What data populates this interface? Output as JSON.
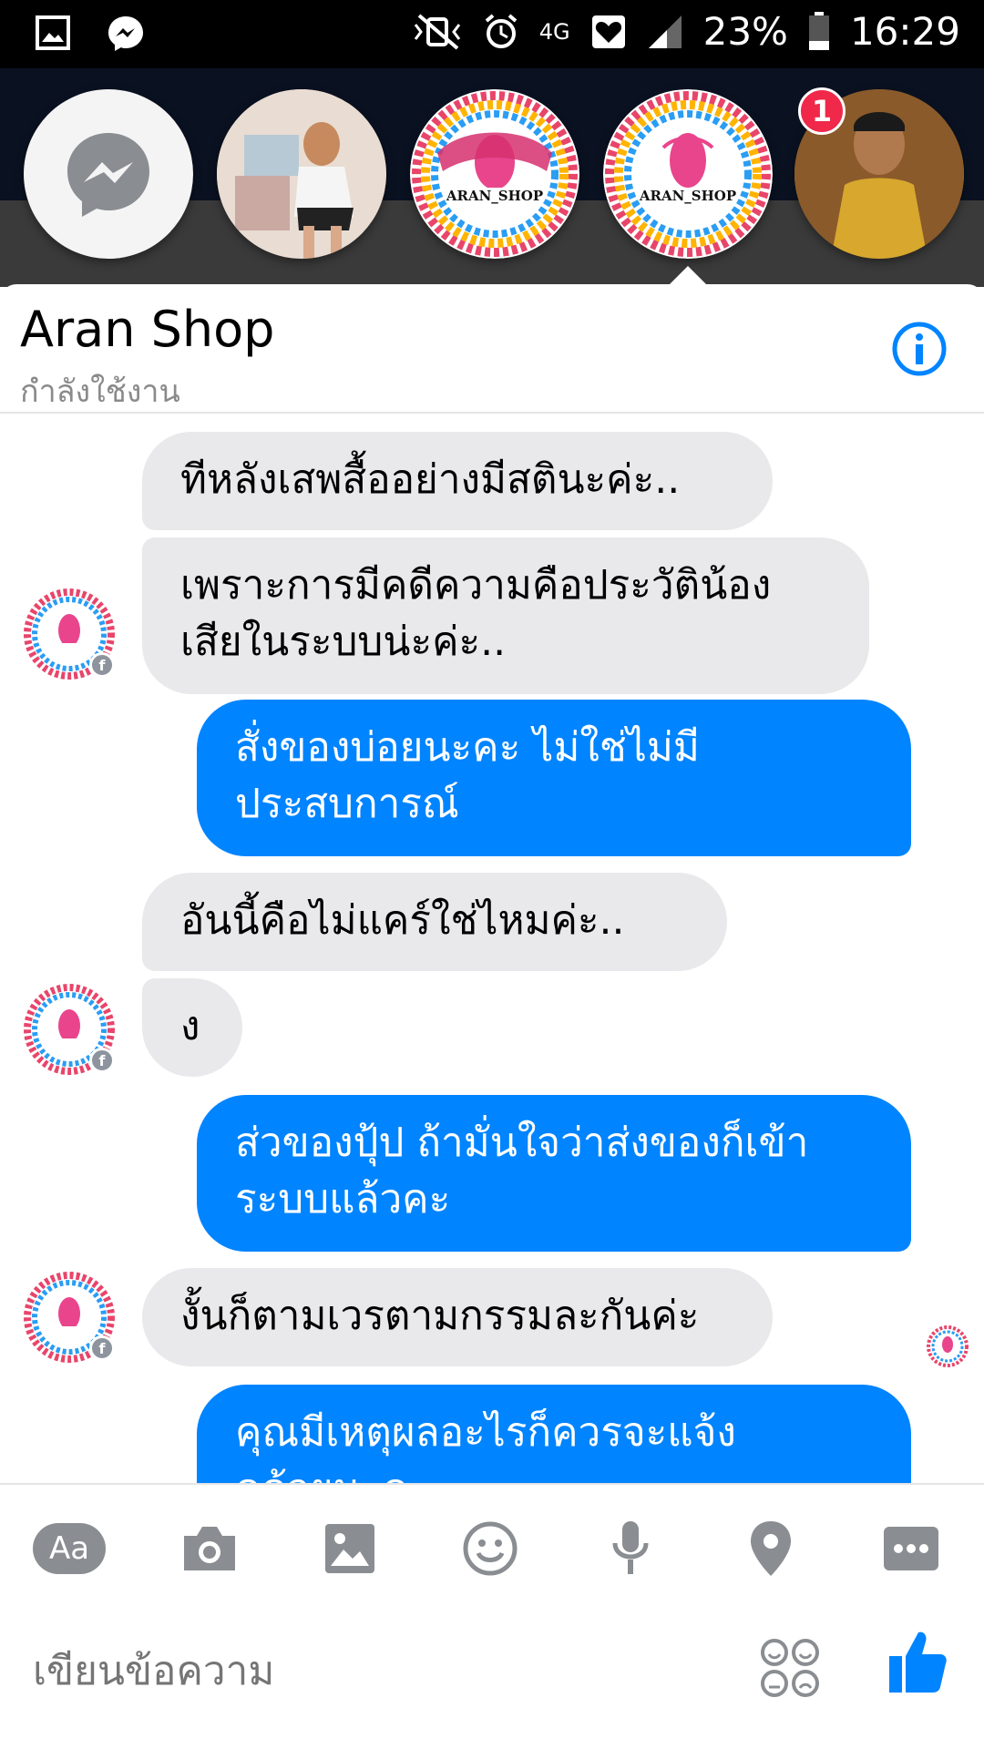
{
  "status_bar": {
    "battery": "23%",
    "time": "16:29",
    "network": "4G"
  },
  "chat_heads": {
    "badge_count": "1",
    "shop_logo_text": "ARAN_SHOP"
  },
  "conversation": {
    "title": "Aran Shop",
    "status": "กำลังใช้งาน"
  },
  "messages": [
    {
      "from": "them",
      "lines": [
        "ทีหลังเสพสื้ออย่างมีสตินะค่ะ.."
      ]
    },
    {
      "from": "them",
      "lines": [
        "เพราะการมีคดีความคือประวัติน้อง",
        "เสียในระบบน่ะค่ะ.."
      ]
    },
    {
      "from": "me",
      "lines": [
        "สั่งของบ่อยนะคะ  ไม่ใช่ไม่มี",
        "ประสบการณ์"
      ]
    },
    {
      "from": "them",
      "lines": [
        "อันนี้คือไม่แคร์ใช่ไหมค่ะ.."
      ]
    },
    {
      "from": "them",
      "lines": [
        "ง"
      ]
    },
    {
      "from": "me",
      "lines": [
        "ส่วของปุ้ป  ถ้ามั่นใจว่าส่งของก็เข้า",
        "ระบบแล้วคะ"
      ]
    },
    {
      "from": "them",
      "lines": [
        "งั้นก็ตามเวรตามกรรมละกันค่ะ"
      ]
    },
    {
      "from": "me",
      "lines": [
        "คุณมีเหตุผลอะไรก็ควรจะแจ้ง",
        "ดูด้วยนะคะ"
      ]
    }
  ],
  "composer": {
    "aa_label": "Aa",
    "placeholder": "เขียนข้อความ"
  },
  "colors": {
    "messenger_blue": "#0084ff",
    "incoming_bubble": "#e9e9eb",
    "badge_red": "#f02849"
  }
}
